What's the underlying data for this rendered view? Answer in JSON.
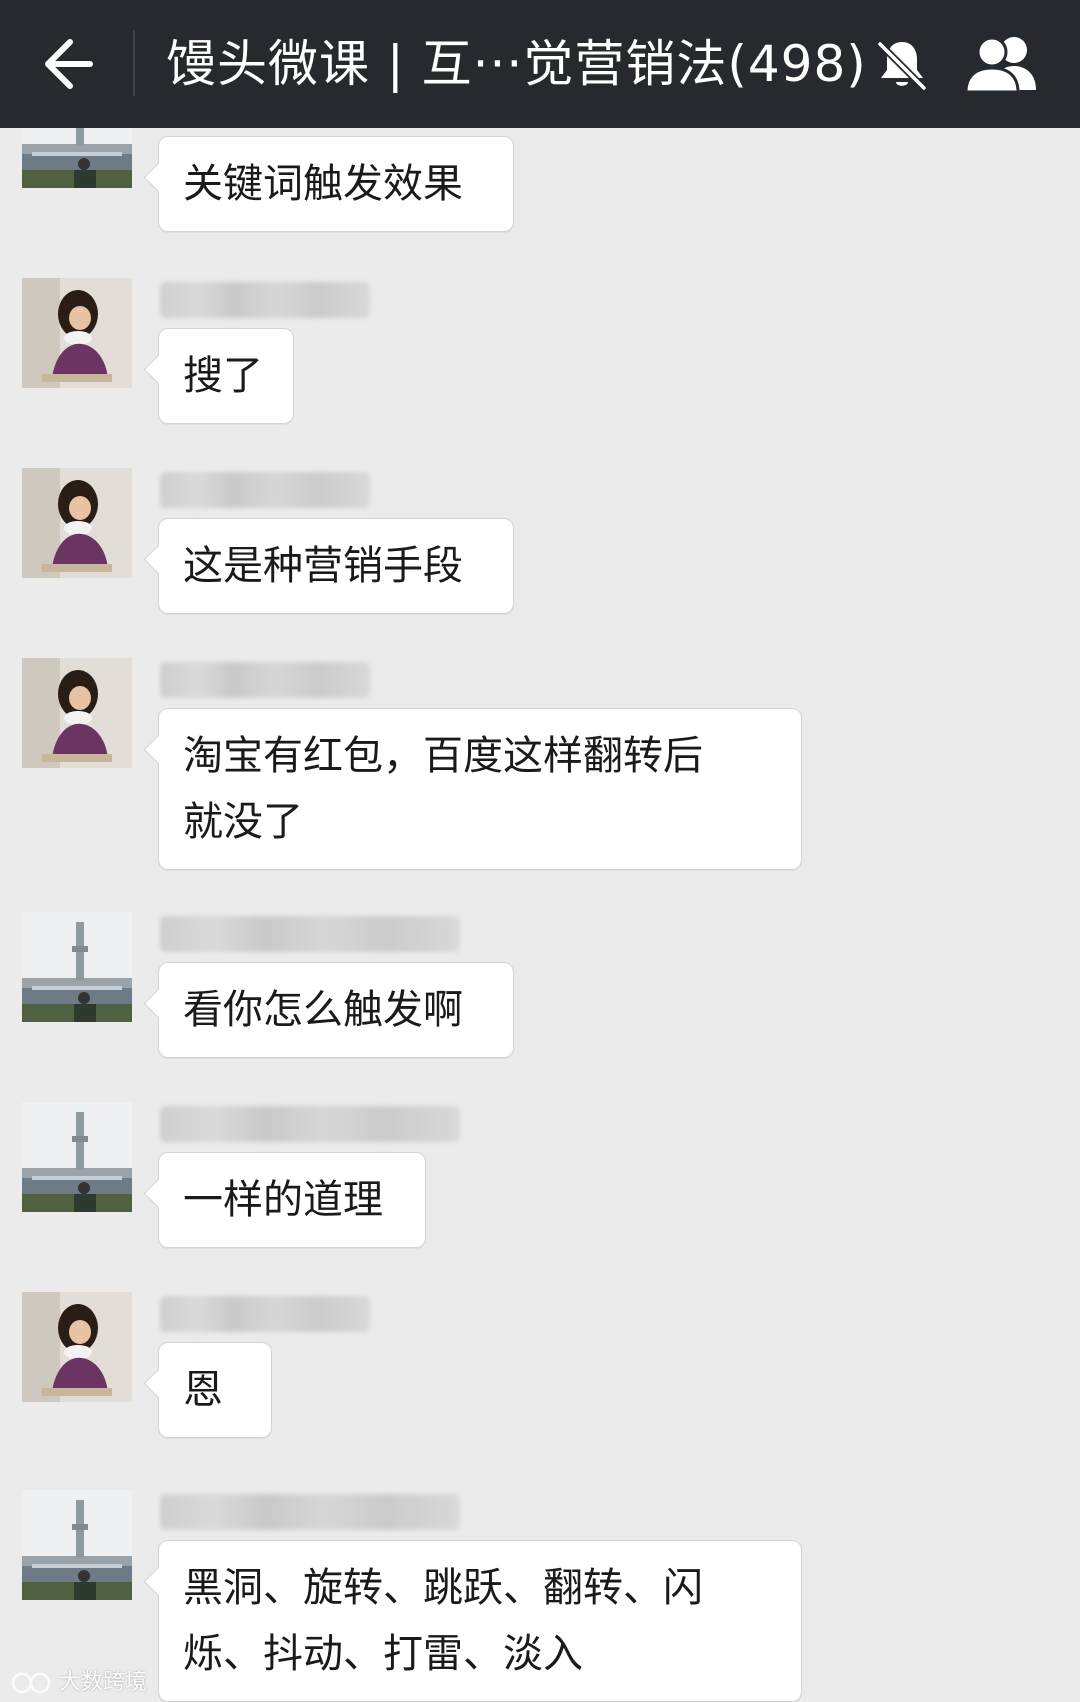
{
  "header": {
    "title": "馒头微课 | 互···觉营销法(498)",
    "back_icon": "back-arrow-icon",
    "mute_icon": "bell-muted-icon",
    "members_icon": "group-members-icon",
    "background": "#262a2e"
  },
  "messages": [
    {
      "sender": "",
      "avatar": "building",
      "text": "关键词触发效果"
    },
    {
      "sender": "",
      "avatar": "girl",
      "text": "搜了"
    },
    {
      "sender": "",
      "avatar": "girl",
      "text": "这是种营销手段"
    },
    {
      "sender": "",
      "avatar": "girl",
      "text": "淘宝有红包，百度这样翻转后\n就没了"
    },
    {
      "sender": "",
      "avatar": "building",
      "text": "看你怎么触发啊"
    },
    {
      "sender": "",
      "avatar": "building",
      "text": "一样的道理"
    },
    {
      "sender": "",
      "avatar": "girl",
      "text": "恩"
    },
    {
      "sender": "",
      "avatar": "building",
      "text": "黑洞、旋转、跳跃、翻转、闪\n烁、抖动、打雷、淡入"
    }
  ],
  "watermark": "大数跨境",
  "colors": {
    "chat_background": "#ebebeb",
    "bubble": "#ffffff"
  }
}
